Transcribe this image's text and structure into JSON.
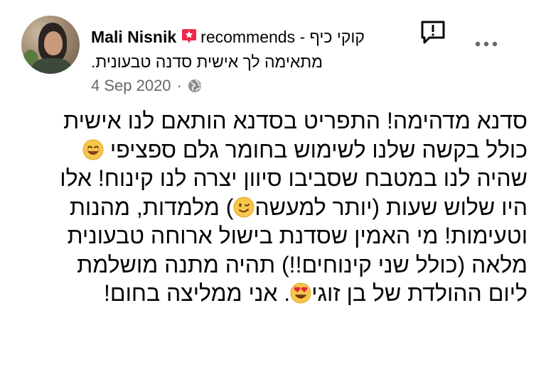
{
  "post": {
    "author": "Mali Nisnik",
    "recommends_word": "recommends",
    "separator": "-",
    "page_name": "קוקי כיף",
    "subtitle": "מתאימה לך אישית סדנה טבעונית.",
    "date": "4 Sep 2020",
    "dot": "·",
    "body_lines": [
      "סדנא מדהימה! התפריט בסדנא הותאם לנו אישית",
      "כולל בקשה שלנו לשימוש בחומר גלם ספציפי",
      "שהיה לנו במטבח שסביבו סיוון יצרה לנו קינוח! אלו",
      "היו שלוש שעות (יותר למעשה",
      ") מלמדות, מהנות",
      "וטעימות! מי האמין שסדנת בישול ארוחה טבעונית",
      "מלאה (כולל שני קינוחים!!) תהיה מתנה מושלמת",
      "ליום ההולדת של בן זוגי",
      ". אני ממליצה בחום!"
    ]
  },
  "icons": {
    "recommend": "recommend-badge-icon",
    "report": "report-exclamation-icon",
    "more": "more-dots-icon",
    "audience": "globe-icon",
    "emoji_smile": "smiling-face-emoji",
    "emoji_wink": "winking-face-emoji",
    "emoji_heart_eyes": "heart-eyes-emoji"
  },
  "colors": {
    "recommend_badge": "#f02849",
    "meta_text": "#65676b",
    "text": "#050505"
  }
}
